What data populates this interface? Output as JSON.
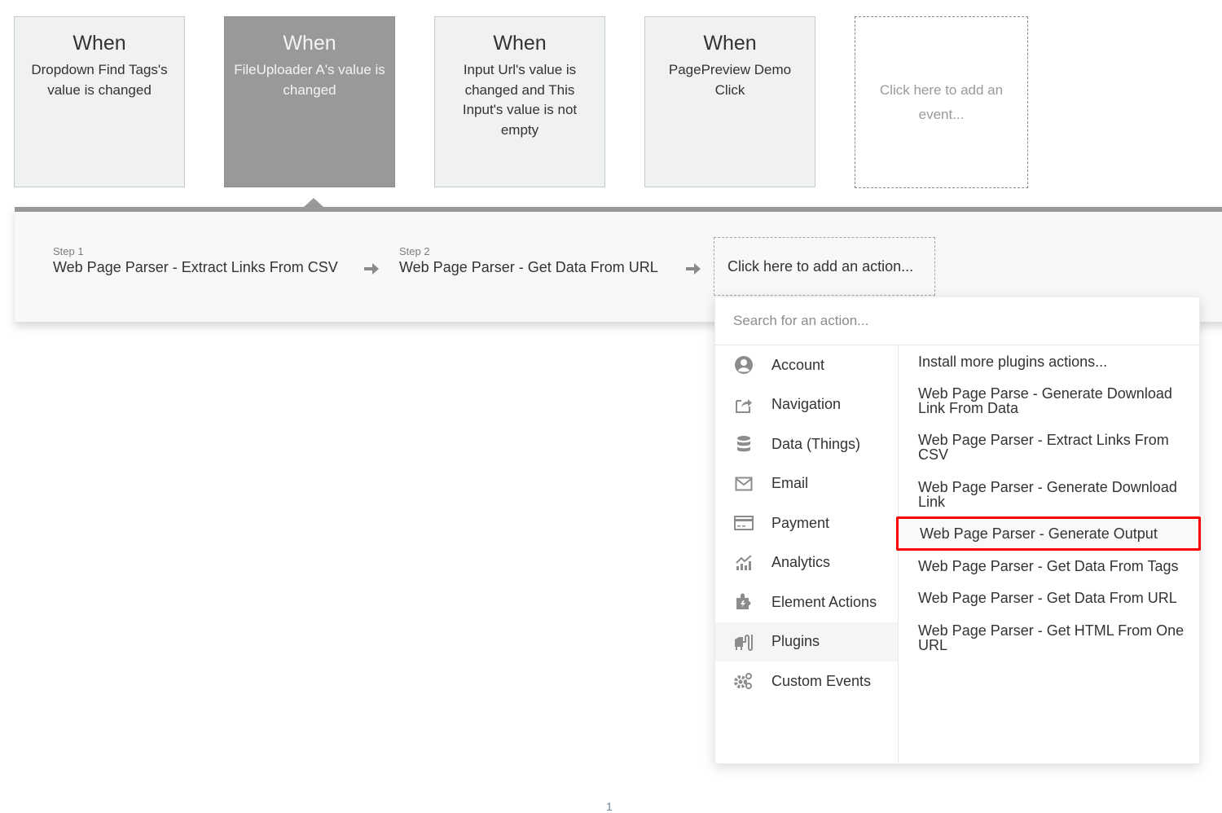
{
  "events": [
    {
      "when": "When",
      "description": "Dropdown Find Tags's value is changed",
      "selected": false
    },
    {
      "when": "When",
      "description": "FileUploader A's value is changed",
      "selected": true
    },
    {
      "when": "When",
      "description": "Input Url's value is changed and This Input's value is not empty",
      "selected": false
    },
    {
      "when": "When",
      "description": "PagePreview Demo Click",
      "selected": false
    }
  ],
  "add_event_label": "Click here to add an event...",
  "steps": [
    {
      "label": "Step 1",
      "name": "Web Page Parser - Extract Links From CSV"
    },
    {
      "label": "Step 2",
      "name": "Web Page Parser - Get Data From URL"
    }
  ],
  "add_action_label": "Click here to add an action...",
  "action_menu": {
    "search_placeholder": "Search for an action...",
    "categories": [
      {
        "label": "Account",
        "icon": "account-icon"
      },
      {
        "label": "Navigation",
        "icon": "navigation-icon"
      },
      {
        "label": "Data (Things)",
        "icon": "database-icon"
      },
      {
        "label": "Email",
        "icon": "email-icon"
      },
      {
        "label": "Payment",
        "icon": "credit-card-icon"
      },
      {
        "label": "Analytics",
        "icon": "analytics-icon"
      },
      {
        "label": "Element Actions",
        "icon": "puzzle-icon"
      },
      {
        "label": "Plugins",
        "icon": "plugin-icon",
        "active": true
      },
      {
        "label": "Custom Events",
        "icon": "gears-icon"
      }
    ],
    "actions": [
      {
        "label": "Install more plugins actions..."
      },
      {
        "label": "Web Page Parse - Generate Download Link From Data"
      },
      {
        "label": "Web Page Parser - Extract Links From CSV"
      },
      {
        "label": "Web Page Parser - Generate Download Link"
      },
      {
        "label": "Web Page Parser - Generate Output",
        "highlighted": true
      },
      {
        "label": "Web Page Parser - Get Data From Tags"
      },
      {
        "label": "Web Page Parser - Get Data From URL"
      },
      {
        "label": "Web Page Parser - Get HTML From One URL"
      }
    ]
  },
  "highlight_color": "#ff0000",
  "page_number": "1"
}
